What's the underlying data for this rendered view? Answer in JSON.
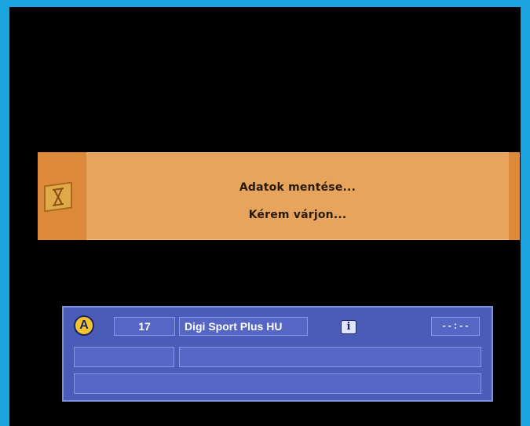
{
  "dialog": {
    "line1": "Adatok mentése...",
    "line2": "Kérem várjon...",
    "icon": "hourglass-icon"
  },
  "banner": {
    "badge": "A",
    "channel_number": "17",
    "channel_name": "Digi Sport Plus HU",
    "info_label": "i",
    "time": "--:--"
  },
  "colors": {
    "frame": "#1aa3dc",
    "screen": "#000000",
    "dialog": "#e6a45c",
    "dialog_strip": "#de8a3a",
    "banner": "#4a5bb8",
    "badge": "#f4c430"
  }
}
